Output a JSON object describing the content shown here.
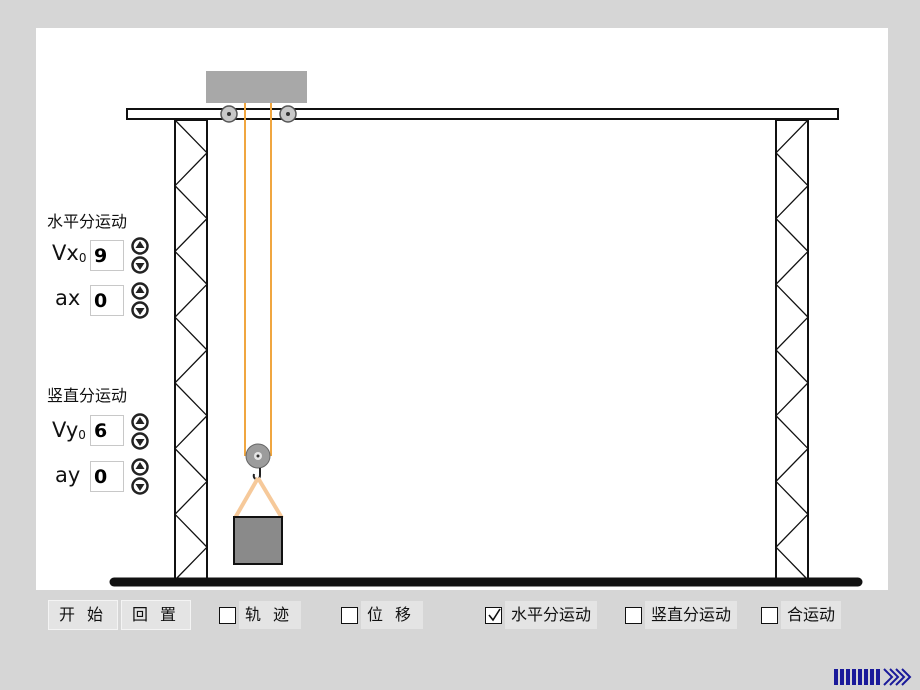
{
  "horizontal": {
    "title": "水平分运动",
    "v0": {
      "label": "V",
      "axis": "x",
      "sub": "0",
      "value": "9"
    },
    "a": {
      "label": "a",
      "axis": "x",
      "value": "0"
    }
  },
  "vertical": {
    "title": "竖直分运动",
    "v0": {
      "label": "V",
      "axis": "y",
      "sub": "0",
      "value": "6"
    },
    "a": {
      "label": "a",
      "axis": "y",
      "value": "0"
    }
  },
  "buttons": {
    "start": "开始",
    "reset": "回置"
  },
  "checkboxes": {
    "trajectory": {
      "label": "轨迹",
      "checked": false
    },
    "displacement": {
      "label": "位移",
      "checked": false
    },
    "horizontal_motion": {
      "label": "水平分运动",
      "checked": true
    },
    "vertical_motion": {
      "label": "竖直分运动",
      "checked": false
    },
    "combined_motion": {
      "label": "合运动",
      "checked": false
    }
  },
  "icons": {
    "spin_up": "up-arrow-circle-icon",
    "spin_down": "down-arrow-circle-icon",
    "next": "next-page-arrows-icon",
    "check": "checkmark-icon"
  },
  "colors": {
    "background": "#d6d6d6",
    "stage": "#ffffff",
    "rope": "#f0a640",
    "sling": "#f6c99a",
    "trolley": "#a8a8a8",
    "load": "#8a8a8a",
    "ground": "#111111",
    "next_arrow": "#1a1a9a"
  }
}
